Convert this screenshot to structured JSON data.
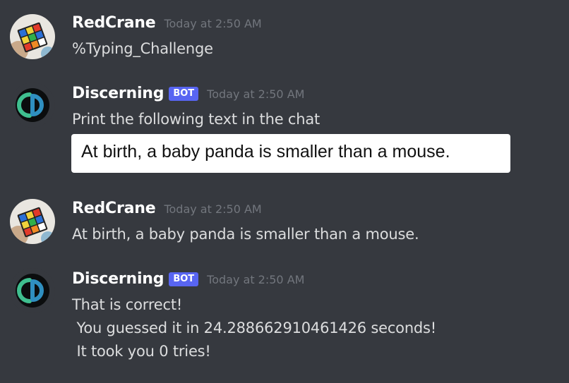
{
  "messages": [
    {
      "author": "RedCrane",
      "timestamp": "Today at 2:50 AM",
      "avatar_icon": "rubiks-cube-avatar",
      "text": "%Typing_Challenge"
    },
    {
      "author": "Discerning",
      "badge": "BOT",
      "timestamp": "Today at 2:50 AM",
      "avatar_icon": "discerning-logo-avatar",
      "text": "Print the following text in the chat",
      "image_text": "At birth, a baby panda is smaller than a mouse."
    },
    {
      "author": "RedCrane",
      "timestamp": "Today at 2:50 AM",
      "avatar_icon": "rubiks-cube-avatar",
      "text": "At birth, a baby panda is smaller than a mouse."
    },
    {
      "author": "Discerning",
      "badge": "BOT",
      "timestamp": "Today at 2:50 AM",
      "avatar_icon": "discerning-logo-avatar",
      "lines": [
        "That is correct!",
        " You guessed it in 24.288662910461426 seconds!",
        " It took you 0 tries!"
      ]
    }
  ],
  "colors": {
    "background": "#36393f",
    "username": "#ffffff",
    "timestamp": "#72767d",
    "message_text": "#dcddde",
    "bot_badge": "#5865f2"
  }
}
